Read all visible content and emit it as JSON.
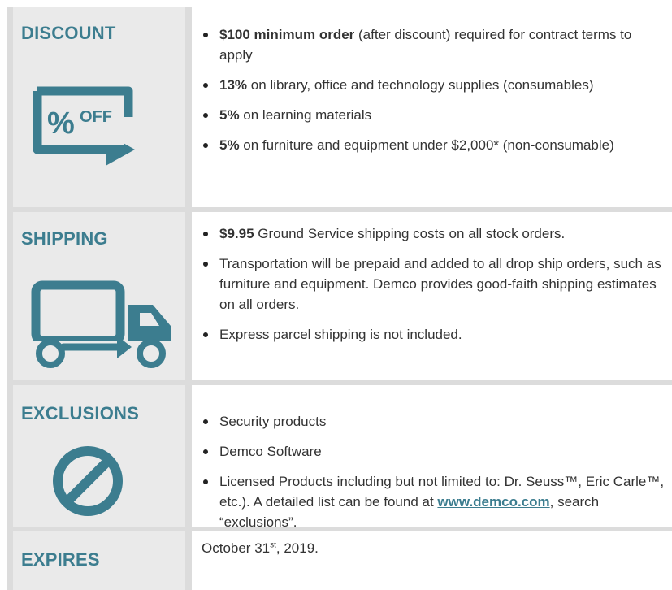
{
  "discount": {
    "label": "DISCOUNT",
    "badge_text": "% OFF",
    "items": [
      {
        "bold": "$100 minimum order",
        "rest": " (after discount) required for contract terms to apply"
      },
      {
        "bold": "13%",
        "rest": " on library, office and technology supplies (consumables)"
      },
      {
        "bold": "5%",
        "rest": " on learning materials"
      },
      {
        "bold": "5%",
        "rest": " on furniture and equipment under $2,000* (non-consumable)"
      }
    ]
  },
  "shipping": {
    "label": "SHIPPING",
    "items": [
      {
        "bold": "$9.95",
        "rest": " Ground Service shipping costs on all stock orders."
      },
      {
        "bold": "",
        "rest": "Transportation will be prepaid and added to all drop ship orders, such as furniture and equipment. Demco provides good-faith shipping estimates on all orders."
      },
      {
        "bold": "",
        "rest": "Express parcel shipping is not included."
      }
    ]
  },
  "exclusions": {
    "label": "EXCLUSIONS",
    "items": [
      "Security products",
      "Demco Software"
    ],
    "last_item_pre": "Licensed Products including but not limited to: Dr. Seuss™, Eric Carle™, etc.). A detailed list can be found at ",
    "last_item_link": "www.demco.com",
    "last_item_post": ", search “exclusions”."
  },
  "expires": {
    "label": "EXPIRES",
    "date_pre": "October 31",
    "date_sup": "st",
    "date_post": ", 2019."
  },
  "colors": {
    "accent": "#3c7d8f",
    "left_bg": "#eaeaea",
    "border": "#dcdcdc"
  },
  "icons": {
    "discount": "percent-off-tag-icon",
    "shipping": "delivery-truck-icon",
    "exclusions": "prohibited-icon"
  }
}
